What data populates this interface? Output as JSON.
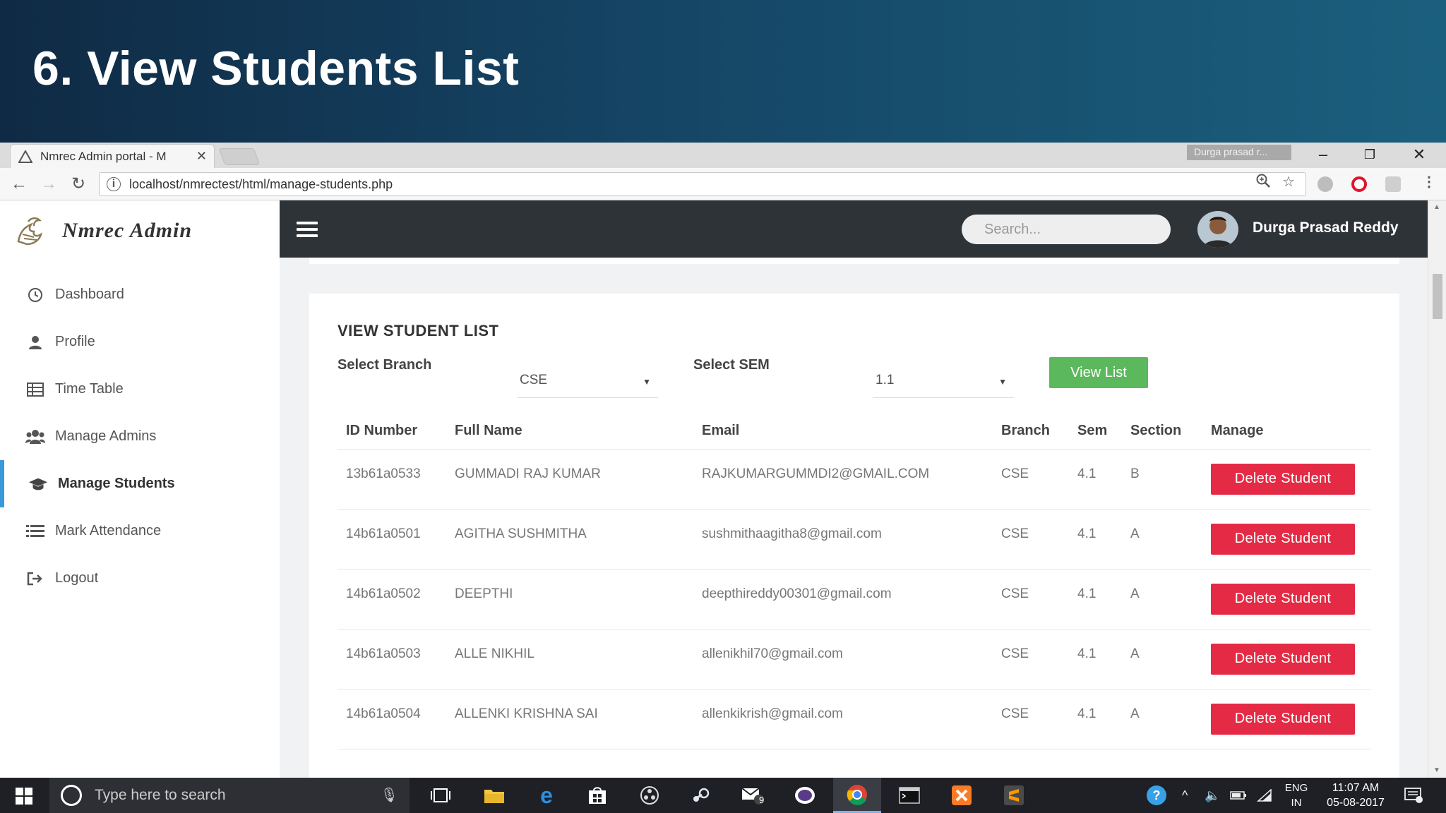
{
  "slide": {
    "title": "6. View Students List"
  },
  "browser": {
    "tab_title": "Nmrec Admin portal - M",
    "profile_chip": "Durga prasad r...",
    "url": "localhost/nmrectest/html/manage-students.php"
  },
  "app": {
    "brand": "Nmrec Admin",
    "sidebar": [
      {
        "label": "Dashboard",
        "icon": "clock-icon"
      },
      {
        "label": "Profile",
        "icon": "user-icon"
      },
      {
        "label": "Time Table",
        "icon": "table-icon"
      },
      {
        "label": "Manage Admins",
        "icon": "users-icon"
      },
      {
        "label": "Manage Students",
        "icon": "graduation-cap-icon",
        "active": true
      },
      {
        "label": "Mark Attendance",
        "icon": "list-icon"
      },
      {
        "label": "Logout",
        "icon": "logout-icon"
      }
    ],
    "search_placeholder": "Search...",
    "user_name": "Durga Prasad Reddy"
  },
  "card": {
    "title": "VIEW STUDENT LIST",
    "branch_label": "Select Branch",
    "branch_value": "CSE",
    "sem_label": "Select SEM",
    "sem_value": "1.1",
    "view_button": "View List"
  },
  "table": {
    "headers": [
      "ID Number",
      "Full Name",
      "Email",
      "Branch",
      "Sem",
      "Section",
      "Manage"
    ],
    "delete_label": "Delete Student",
    "rows": [
      [
        "13b61a0533",
        "GUMMADI RAJ KUMAR",
        "RAJKUMARGUMMDI2@GMAIL.COM",
        "CSE",
        "4.1",
        "B"
      ],
      [
        "14b61a0501",
        "AGITHA SUSHMITHA",
        "sushmithaagitha8@gmail.com",
        "CSE",
        "4.1",
        "A"
      ],
      [
        "14b61a0502",
        "DEEPTHI",
        "deepthireddy00301@gmail.com",
        "CSE",
        "4.1",
        "A"
      ],
      [
        "14b61a0503",
        "ALLE NIKHIL",
        "allenikhil70@gmail.com",
        "CSE",
        "4.1",
        "A"
      ],
      [
        "14b61a0504",
        "ALLENKI KRISHNA SAI",
        "allenkikrish@gmail.com",
        "CSE",
        "4.1",
        "A"
      ]
    ]
  },
  "taskbar": {
    "search_text": "Type here to search",
    "mail_badge": "9",
    "lang_1": "ENG",
    "lang_2": "IN",
    "time": "11:07 AM",
    "date": "05-08-2017"
  },
  "colors": {
    "sidebar_active_accent": "#3a9ad9",
    "topbar": "#2e3338",
    "view_button": "#5cb85c",
    "delete_button": "#e42a45"
  }
}
